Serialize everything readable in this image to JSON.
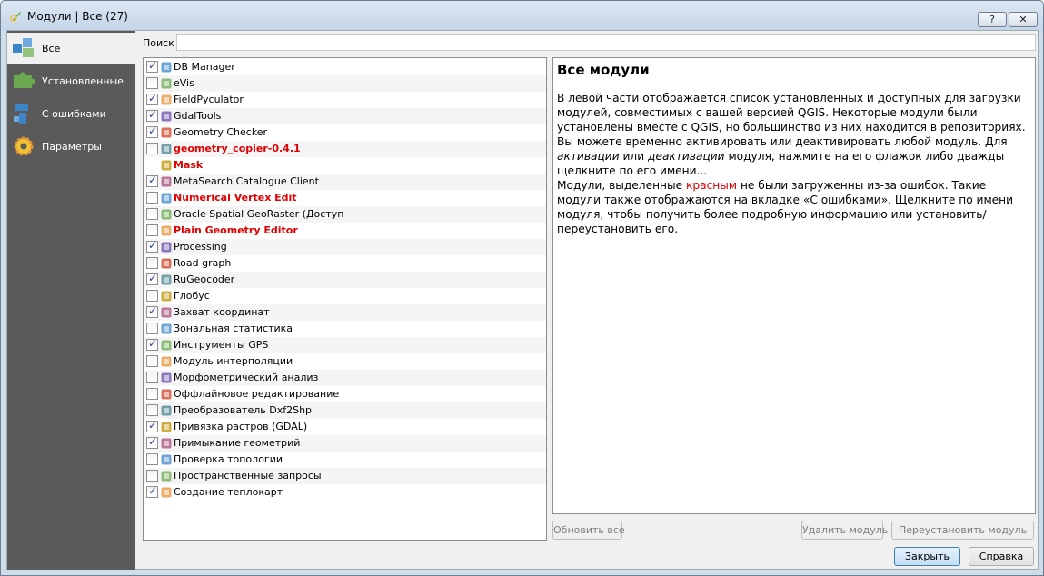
{
  "window": {
    "title": "Модули | Все (27)",
    "help_label": "?",
    "close_label": "✕"
  },
  "sidebar": {
    "items": [
      {
        "label": "Все",
        "icon": "puzzle-all-icon",
        "active": true
      },
      {
        "label": "Установленные",
        "icon": "puzzle-installed-icon",
        "active": false
      },
      {
        "label": "С ошибками",
        "icon": "puzzle-broken-icon",
        "active": false
      },
      {
        "label": "Параметры",
        "icon": "gear-icon",
        "active": false
      }
    ]
  },
  "search": {
    "label": "Поиск",
    "value": "",
    "placeholder": ""
  },
  "plugins": [
    {
      "name": "DB Manager",
      "checked": true,
      "error": false,
      "icon": "database-icon"
    },
    {
      "name": "eVis",
      "checked": false,
      "error": false,
      "icon": "evis-icon"
    },
    {
      "name": "FieldPyculator",
      "checked": true,
      "error": false,
      "icon": "calculator-icon"
    },
    {
      "name": "GdalTools",
      "checked": true,
      "error": false,
      "icon": "gdal-icon"
    },
    {
      "name": "Geometry Checker",
      "checked": true,
      "error": false,
      "icon": "geometry-checker-icon"
    },
    {
      "name": "geometry_copier-0.4.1",
      "checked": false,
      "error": true,
      "icon": "puzzle-icon"
    },
    {
      "name": "Mask",
      "checked": null,
      "error": true,
      "icon": "mask-icon"
    },
    {
      "name": "MetaSearch Catalogue Client",
      "checked": true,
      "error": false,
      "icon": "metasearch-icon"
    },
    {
      "name": "Numerical Vertex Edit",
      "checked": false,
      "error": true,
      "icon": "vertex-edit-icon"
    },
    {
      "name": "Oracle Spatial GeoRaster (Доступ",
      "checked": false,
      "error": false,
      "icon": "oracle-icon"
    },
    {
      "name": "Plain Geometry Editor",
      "checked": false,
      "error": true,
      "icon": "geometry-editor-icon"
    },
    {
      "name": "Processing",
      "checked": true,
      "error": false,
      "icon": "processing-gear-icon"
    },
    {
      "name": "Road graph",
      "checked": false,
      "error": false,
      "icon": "road-graph-icon"
    },
    {
      "name": "RuGeocoder",
      "checked": true,
      "error": false,
      "icon": "geocoder-icon"
    },
    {
      "name": "Глобус",
      "checked": false,
      "error": false,
      "icon": "globe-icon"
    },
    {
      "name": "Захват координат",
      "checked": true,
      "error": false,
      "icon": "crosshair-icon"
    },
    {
      "name": "Зональная статистика",
      "checked": false,
      "error": false,
      "icon": "zonal-stats-icon"
    },
    {
      "name": "Инструменты GPS",
      "checked": true,
      "error": false,
      "icon": "gps-icon"
    },
    {
      "name": "Модуль интерполяции",
      "checked": false,
      "error": false,
      "icon": "interpolation-icon"
    },
    {
      "name": "Морфометрический анализ",
      "checked": false,
      "error": false,
      "icon": "morphometry-icon"
    },
    {
      "name": "Оффлайновое редактирование",
      "checked": false,
      "error": false,
      "icon": "offline-edit-icon"
    },
    {
      "name": "Преобразователь Dxf2Shp",
      "checked": false,
      "error": false,
      "icon": "dxf-icon"
    },
    {
      "name": "Привязка растров (GDAL)",
      "checked": true,
      "error": false,
      "icon": "georeferencer-icon"
    },
    {
      "name": "Примыкание геометрий",
      "checked": true,
      "error": false,
      "icon": "snap-icon"
    },
    {
      "name": "Проверка топологии",
      "checked": false,
      "error": false,
      "icon": "topology-icon"
    },
    {
      "name": "Пространственные запросы",
      "checked": false,
      "error": false,
      "icon": "spatial-query-icon"
    },
    {
      "name": "Создание теплокарт",
      "checked": true,
      "error": false,
      "icon": "heatmap-icon"
    }
  ],
  "description": {
    "title": "Все модули",
    "p1": "В левой части отображается список установленных и доступных для загрузки модулей, совместимых с вашей версией QGIS. Некоторые модули были установлены вместе с QGIS, но большинство из них находится в репозиториях.",
    "p2_a": "Вы можете временно активировать или деактивировать любой модуль. Для ",
    "p2_b": "активации",
    "p2_c": " или ",
    "p2_d": "деактивации",
    "p2_e": " модуля, нажмите на его флажок либо дважды щелкните по его имени...",
    "p3_a": "Модули, выделенные ",
    "p3_b": "красным",
    "p3_c": " не были загруженны из-за ошибок. Такие модули также отображаются на вкладке «С ошибками». Щелкните по имени модуля, чтобы получить более подробную информацию или установить/переустановить его.",
    "error_color": "#e00000"
  },
  "buttons": {
    "upgrade_all": "Обновить все",
    "uninstall": "Удалить модуль",
    "reinstall": "Переустановить модуль",
    "close": "Закрыть",
    "help": "Справка"
  }
}
